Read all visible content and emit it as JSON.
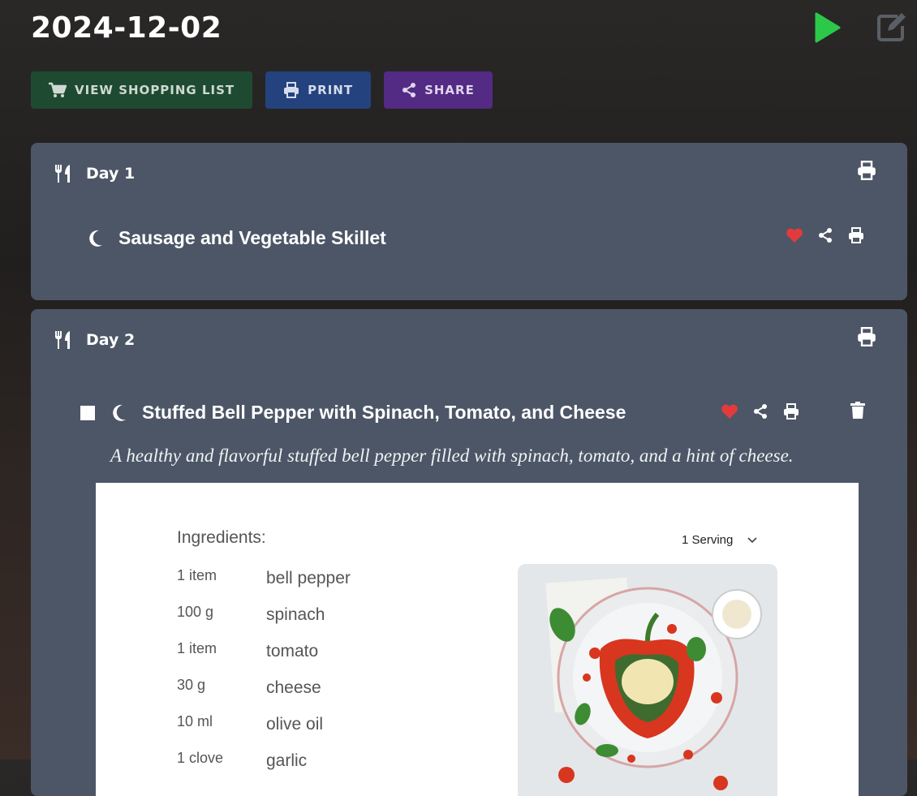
{
  "page": {
    "title": "2024-12-02"
  },
  "toolbar": {
    "shopping_label": "VIEW SHOPPING LIST",
    "print_label": "PRINT",
    "share_label": "SHARE"
  },
  "colors": {
    "play": "#2cc84a",
    "heart": "#e23b3b",
    "card": "#4c5666"
  },
  "days": [
    {
      "label": "Day 1",
      "meals": [
        {
          "title": "Sausage and Vegetable Skillet"
        }
      ]
    },
    {
      "label": "Day 2",
      "meals": [
        {
          "title": "Stuffed Bell Pepper with Spinach, Tomato, and Cheese",
          "description": "A healthy and flavorful stuffed bell pepper filled with spinach, tomato, and a hint of cheese.",
          "ingredients_title": "Ingredients:",
          "serving_label": "1 Serving",
          "ingredients": [
            {
              "qty": "1 item",
              "name": "bell pepper"
            },
            {
              "qty": "100 g",
              "name": "spinach"
            },
            {
              "qty": "1 item",
              "name": "tomato"
            },
            {
              "qty": "30 g",
              "name": "cheese"
            },
            {
              "qty": "10 ml",
              "name": "olive oil"
            },
            {
              "qty": "1 clove",
              "name": "garlic"
            }
          ]
        }
      ]
    }
  ]
}
